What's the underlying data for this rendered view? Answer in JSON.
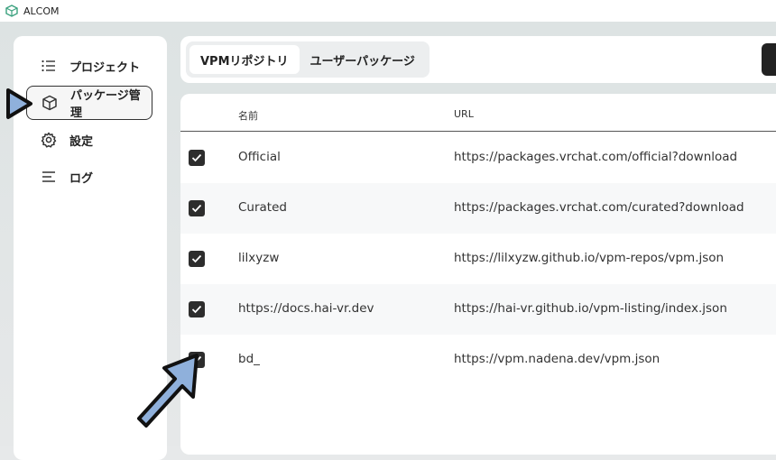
{
  "window": {
    "title": "ALCOM"
  },
  "sidebar": {
    "items": [
      {
        "label": "プロジェクト",
        "icon": "list-icon",
        "active": false
      },
      {
        "label": "パッケージ管理",
        "icon": "package-icon",
        "active": true
      },
      {
        "label": "設定",
        "icon": "gear-icon",
        "active": false
      },
      {
        "label": "ログ",
        "icon": "log-lines-icon",
        "active": false
      }
    ]
  },
  "tabs": [
    {
      "label": "VPMリポジトリ",
      "active": true
    },
    {
      "label": "ユーザーパッケージ",
      "active": false
    }
  ],
  "table": {
    "headers": {
      "name": "名前",
      "url": "URL"
    },
    "rows": [
      {
        "checked": true,
        "name": "Official",
        "url": "https://packages.vrchat.com/official?download"
      },
      {
        "checked": true,
        "name": "Curated",
        "url": "https://packages.vrchat.com/curated?download"
      },
      {
        "checked": true,
        "name": "lilxyzw",
        "url": "https://lilxyzw.github.io/vpm-repos/vpm.json"
      },
      {
        "checked": true,
        "name": "https://docs.hai-vr.dev",
        "url": "https://hai-vr.github.io/vpm-listing/index.json"
      },
      {
        "checked": true,
        "name": "bd_",
        "url": "https://vpm.nadena.dev/vpm.json"
      }
    ]
  },
  "colors": {
    "accent_arrow": "#8fb0db",
    "checkbox": "#2d2d2d",
    "app_icon": "#3aa17e"
  }
}
